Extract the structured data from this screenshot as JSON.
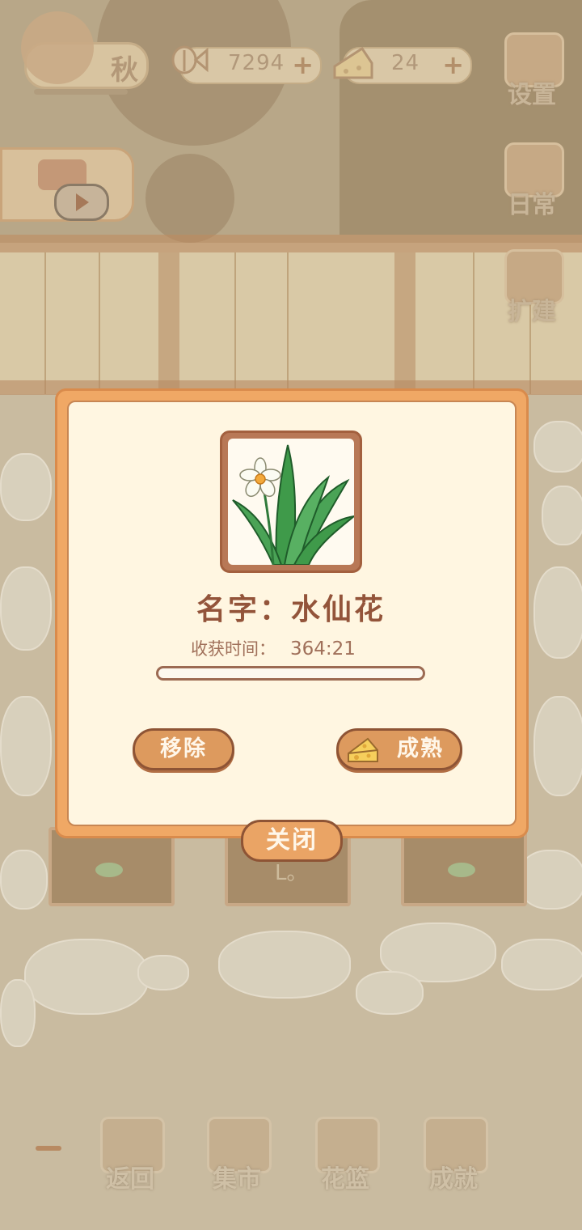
{
  "hud": {
    "season_label": "秋",
    "fish_count": "7294",
    "cheese_count": "24",
    "add_symbol": "+"
  },
  "side_menu": {
    "settings_label": "设置",
    "daily_label": "日常",
    "expand_label": "扩建"
  },
  "garden": {
    "plot_hint": "L。"
  },
  "bottom_nav": {
    "back_label": "返回",
    "market_label": "集市",
    "basket_label": "花篮",
    "achievement_label": "成就"
  },
  "dialog": {
    "name_label": "名字：水仙花",
    "harvest_time_label": "收获时间：",
    "harvest_time_value": "364:21",
    "progress": 0.0,
    "remove_label": "移除",
    "mature_label": "成熟",
    "close_label": "关闭"
  },
  "colors": {
    "dialog_border": "#f0a865",
    "dialog_bg": "#fff6e1",
    "title_text": "#93543a",
    "button_fill": "#dd9a5e",
    "button_outline": "#8e5435"
  },
  "icons": {
    "plant": "daffodil-icon",
    "mature_button": "cheese-icon",
    "fish_resource": "fish-bone-icon",
    "cheese_resource": "cheese-icon"
  }
}
